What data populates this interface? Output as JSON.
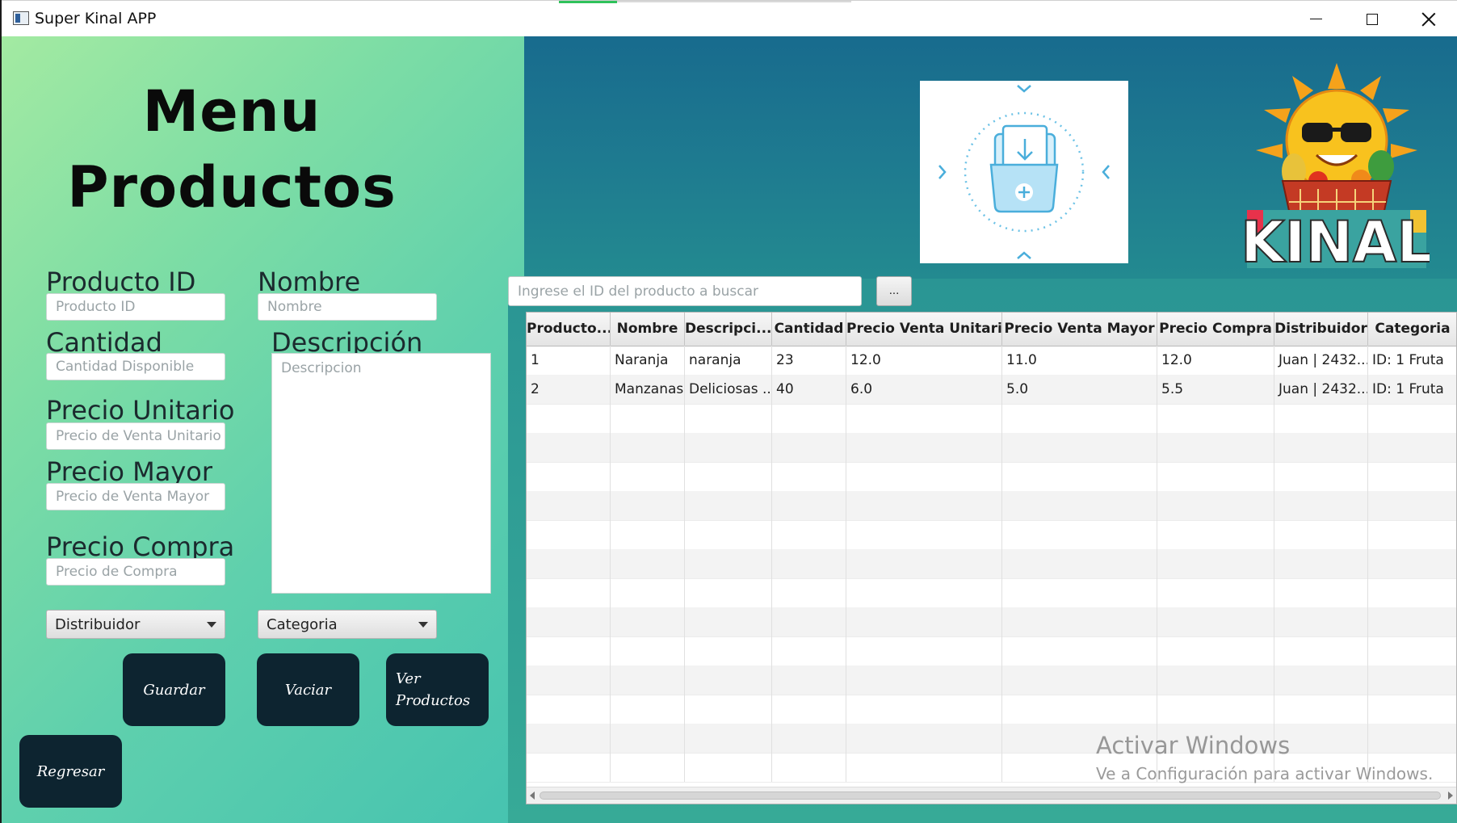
{
  "window": {
    "title": "Super Kinal APP"
  },
  "form": {
    "heading_line1": "Menu",
    "heading_line2": "Productos",
    "producto_id": {
      "label": "Producto ID",
      "placeholder": "Producto ID"
    },
    "nombre": {
      "label": "Nombre",
      "placeholder": "Nombre"
    },
    "cantidad": {
      "label": "Cantidad",
      "placeholder": "Cantidad Disponible"
    },
    "descripcion": {
      "label": "Descripción",
      "placeholder": "Descripcion"
    },
    "precio_unitario": {
      "label": "Precio Unitario",
      "placeholder": "Precio de Venta Unitario"
    },
    "precio_mayor": {
      "label": "Precio Mayor",
      "placeholder": "Precio de Venta Mayor"
    },
    "precio_compra": {
      "label": "Precio Compra",
      "placeholder": "Precio de Compra"
    },
    "distribuidor_combo": "Distribuidor",
    "categoria_combo": "Categoria"
  },
  "buttons": {
    "guardar": "Guardar",
    "vaciar": "Vaciar",
    "ver_line1": "Ver",
    "ver_line2": "Productos",
    "regresar": "Regresar"
  },
  "search": {
    "placeholder": "Ingrese el ID del producto a buscar",
    "button": "..."
  },
  "logo": {
    "text": "KINAL"
  },
  "table": {
    "columns": [
      "Producto...",
      "Nombre",
      "Descripci...",
      "Cantidad",
      "Precio Venta Unitario",
      "Precio Venta Mayor",
      "Precio Compra",
      "Distribuidor",
      "Categoria"
    ],
    "rows": [
      [
        "1",
        "Naranja",
        "naranja",
        "23",
        "12.0",
        "11.0",
        "12.0",
        "Juan | 2432...",
        "ID: 1 Fruta"
      ],
      [
        "2",
        "Manzanas",
        "Deliciosas ...",
        "40",
        "6.0",
        "5.0",
        "5.5",
        "Juan | 2432...",
        "ID: 1 Fruta"
      ]
    ]
  },
  "watermark": {
    "line1": "Activar Windows",
    "line2": "Ve a Configuración para activar Windows."
  }
}
